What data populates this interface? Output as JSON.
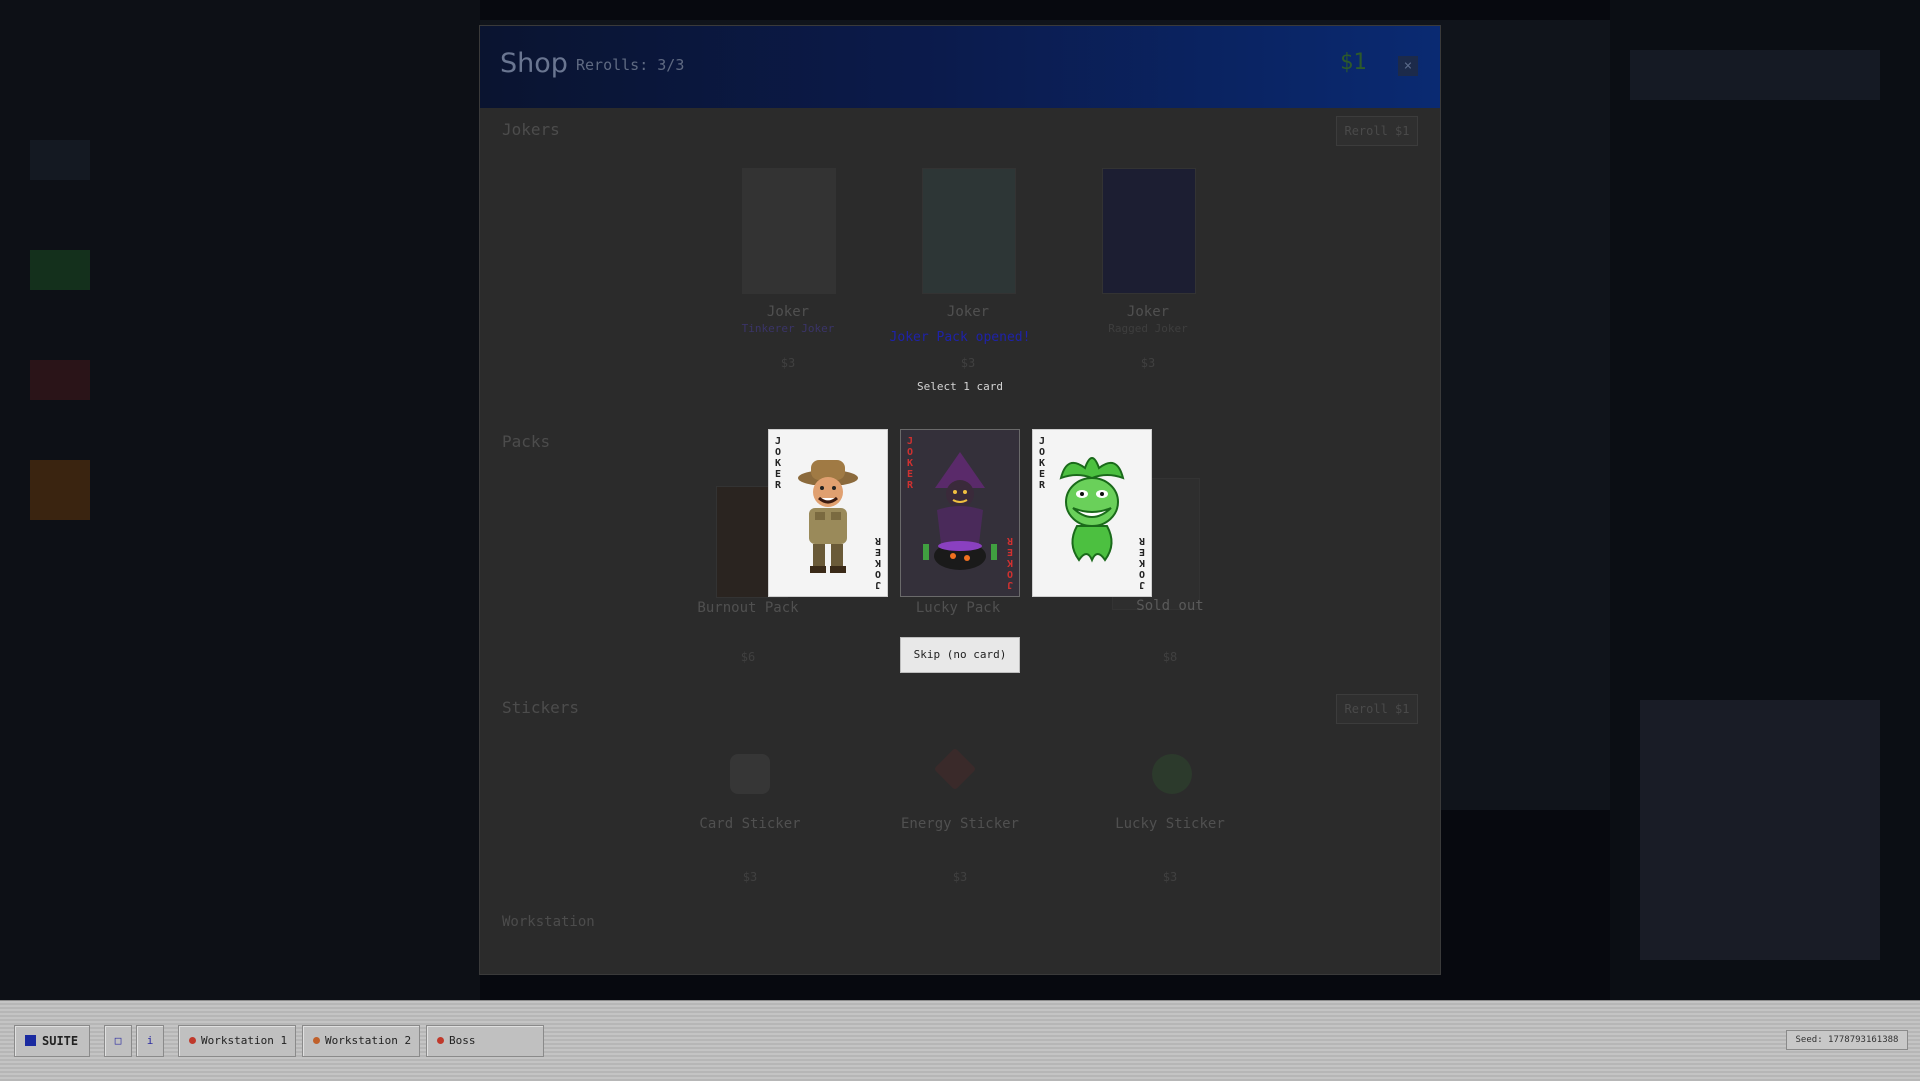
{
  "shop": {
    "title": "Shop",
    "rerolls": "Rerolls: 3/3",
    "money": "$1",
    "close": "×",
    "sections": {
      "jokers": {
        "label": "Jokers",
        "reroll": "Reroll $1"
      },
      "packs": {
        "label": "Packs"
      },
      "stickers": {
        "label": "Stickers",
        "reroll": "Reroll $1"
      },
      "workstation": {
        "label": "Workstation"
      }
    },
    "jokers": [
      {
        "name": "Joker",
        "subtitle": "Tinkerer Joker",
        "price": "$3"
      },
      {
        "name": "Joker",
        "subtitle": "",
        "price": "$3"
      },
      {
        "name": "Joker",
        "subtitle": "Ragged Joker",
        "price": "$3"
      }
    ],
    "packs": [
      {
        "name": "Burnout Pack",
        "price": "$6"
      },
      {
        "name": "Lucky Pack",
        "price": ""
      },
      {
        "name": "Sold out",
        "price": "$8"
      }
    ],
    "stickers": [
      {
        "name": "Card Sticker",
        "price": "$3"
      },
      {
        "name": "Energy Sticker",
        "price": "$3"
      },
      {
        "name": "Lucky Sticker",
        "price": "$3"
      }
    ]
  },
  "pack_overlay": {
    "opened_text": "Joker Pack opened!",
    "select_label": "Select 1 card",
    "cards": [
      {
        "corner": "JOKER",
        "icon": "safari-joker-icon"
      },
      {
        "corner": "JOKER",
        "icon": "witch-joker-icon"
      },
      {
        "corner": "JOKER",
        "icon": "green-jester-icon"
      }
    ],
    "skip_label": "Skip (no card)"
  },
  "taskbar": {
    "suite_label": "SUITE",
    "small_buttons": [
      "□",
      "i"
    ],
    "tabs": [
      {
        "label": "Workstation 1",
        "dot_color": "#c0392b"
      },
      {
        "label": "Workstation 2",
        "dot_color": "#c0602b"
      },
      {
        "label": "Boss",
        "dot_color": "#c0392b"
      }
    ],
    "seed": "Seed: 1778793161388"
  },
  "colors": {
    "overlay_text": "#1e22a8",
    "skip_button_bg": "#e8e8e8",
    "header_gradient_end": "#0a2a72"
  }
}
